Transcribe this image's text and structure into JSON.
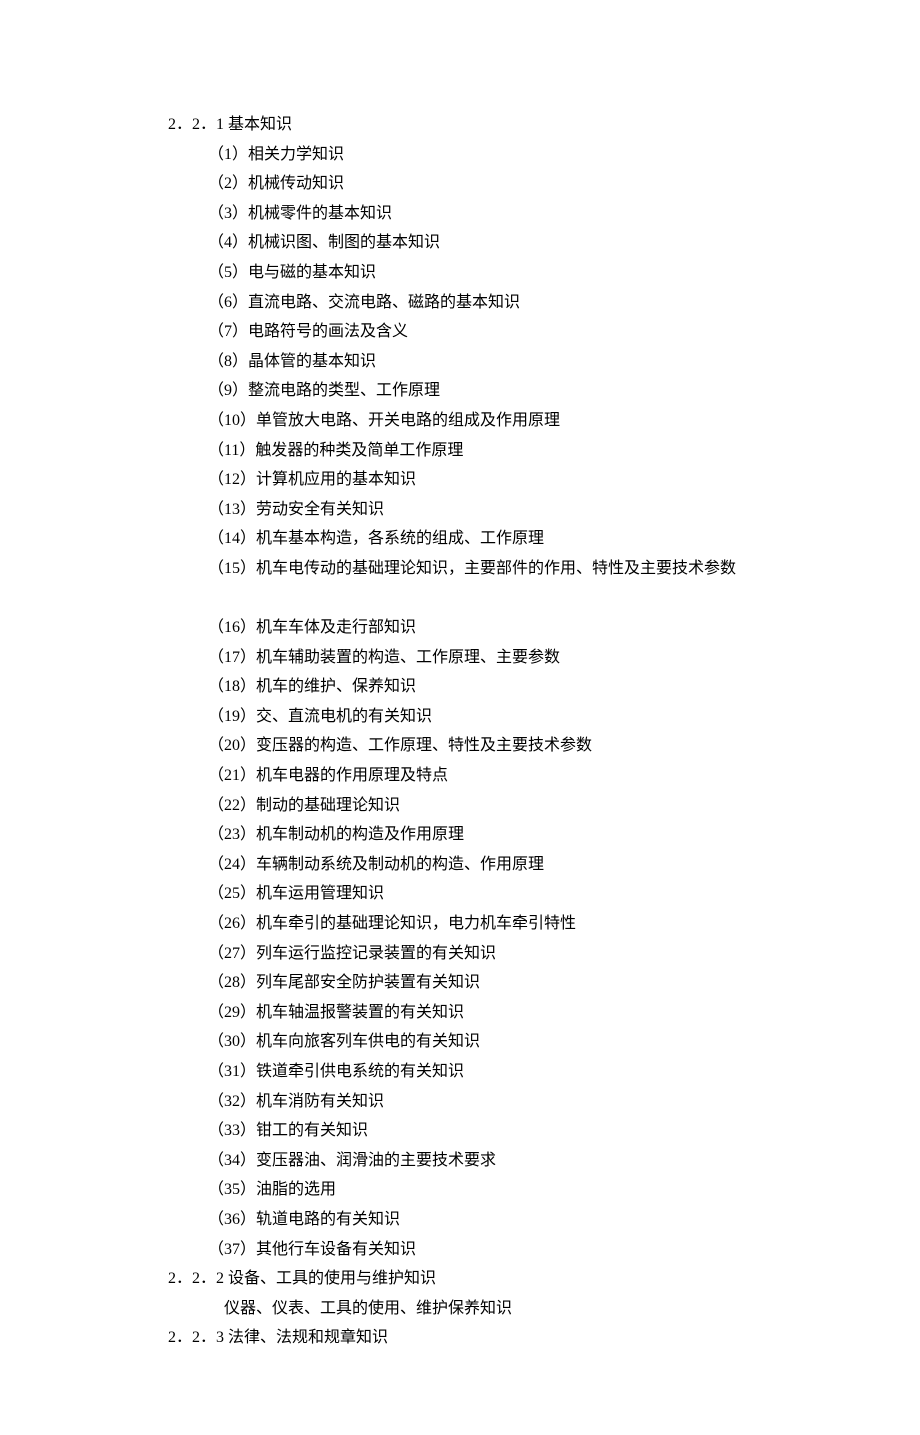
{
  "sections": [
    {
      "heading": "2．2．1 基本知识",
      "items": [
        "（1）相关力学知识",
        "（2）机械传动知识",
        "（3）机械零件的基本知识",
        "（4）机械识图、制图的基本知识",
        "（5）电与磁的基本知识",
        "（6）直流电路、交流电路、磁路的基本知识",
        "（7）电路符号的画法及含义",
        "（8）晶体管的基本知识",
        "（9）整流电路的类型、工作原理",
        "（10）单管放大电路、开关电路的组成及作用原理",
        "（11）触发器的种类及简单工作原理",
        "（12）计算机应用的基本知识",
        "（13）劳动安全有关知识",
        "（14）机车基本构造，各系统的组成、工作原理",
        "（15）机车电传动的基础理论知识，主要部件的作用、特性及主要技术参数",
        "",
        "（16）机车车体及走行部知识",
        "（17）机车辅助装置的构造、工作原理、主要参数",
        "（18）机车的维护、保养知识",
        "（19）交、直流电机的有关知识",
        "（20）变压器的构造、工作原理、特性及主要技术参数",
        "（21）机车电器的作用原理及特点",
        "（22）制动的基础理论知识",
        "（23）机车制动机的构造及作用原理",
        "（24）车辆制动系统及制动机的构造、作用原理",
        "（25）机车运用管理知识",
        "（26）机车牵引的基础理论知识，电力机车牵引特性",
        "（27）列车运行监控记录装置的有关知识",
        "（28）列车尾部安全防护装置有关知识",
        "（29）机车轴温报警装置的有关知识",
        "（30）机车向旅客列车供电的有关知识",
        "（31）铁道牵引供电系统的有关知识",
        "（32）机车消防有关知识",
        "（33）钳工的有关知识",
        "（34）变压器油、润滑油的主要技术要求",
        "（35）油脂的选用",
        "（36）轨道电路的有关知识",
        "（37）其他行车设备有关知识"
      ]
    },
    {
      "heading": "2．2．2 设备、工具的使用与维护知识",
      "subitems": [
        "仪器、仪表、工具的使用、维护保养知识"
      ]
    },
    {
      "heading": "2．2．3 法律、法规和规章知识"
    }
  ]
}
